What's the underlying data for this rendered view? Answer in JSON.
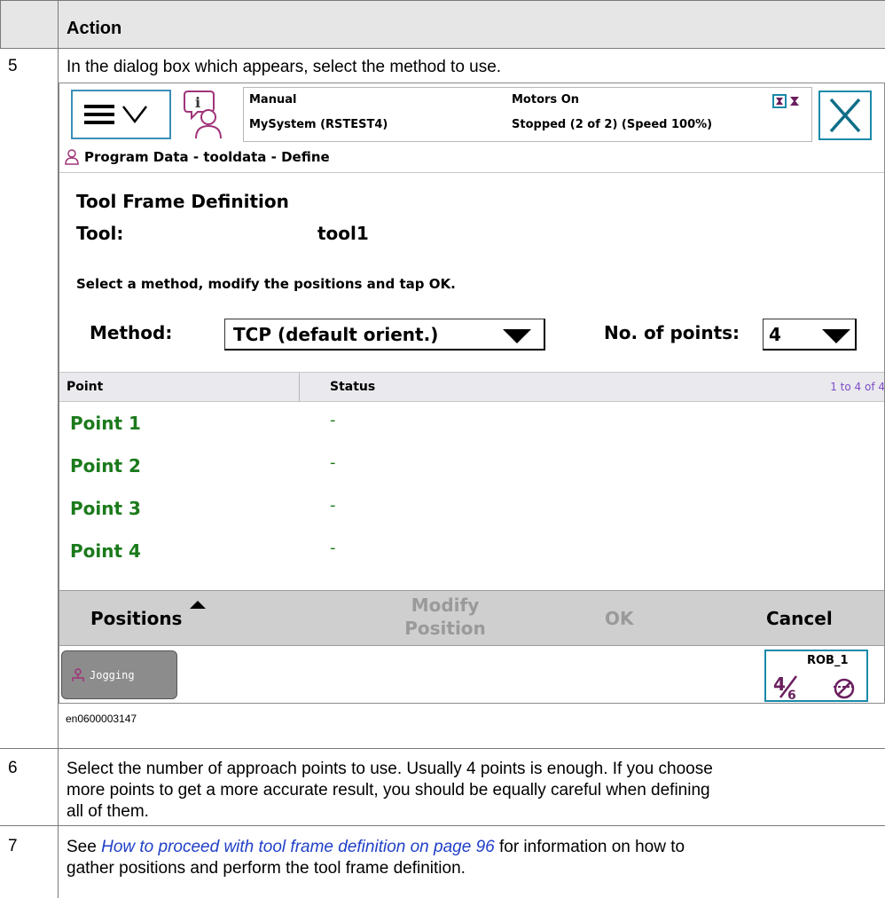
{
  "table": {
    "header": "Action",
    "steps": [
      {
        "num": "5",
        "text": "In the dialog box which appears, select the method to use."
      },
      {
        "num": "6",
        "lines": [
          "Select the number of approach points to use. Usually 4 points is enough. If you choose",
          "more points to get a more accurate result, you should be equally careful when defining",
          "all of them."
        ]
      },
      {
        "num": "7",
        "link": "How to proceed with tool frame definition on page 96",
        "after": " for information on how to",
        "prefix": "See ",
        "line2": "gather positions and perform the tool frame definition."
      }
    ],
    "figure_caption": "en0600003147"
  },
  "screen": {
    "status": {
      "mode": "Manual",
      "system": "MySystem (RSTEST4)",
      "motors": "Motors On",
      "state": "Stopped (2 of 2) (Speed 100%)"
    },
    "breadcrumb": "Program Data - tooldata - Define",
    "frame_title": "Tool Frame Definition",
    "tool_label": "Tool:",
    "tool_value": "tool1",
    "instruction": "Select a method, modify the positions and tap OK.",
    "method_label": "Method:",
    "method_value": "TCP (default orient.)",
    "points_label": "No. of points:",
    "points_value": "4",
    "grid": {
      "columns": [
        "Point",
        "Status"
      ],
      "range": "1 to 4 of 4",
      "rows": [
        {
          "point": "Point  1",
          "status": "-"
        },
        {
          "point": "Point  2",
          "status": "-"
        },
        {
          "point": "Point  3",
          "status": "-"
        },
        {
          "point": "Point  4",
          "status": "-"
        }
      ]
    },
    "commands": {
      "positions": "Positions",
      "modify_line1": "Modify",
      "modify_line2": "Position",
      "ok": "OK",
      "cancel": "Cancel"
    },
    "jogging": "Jogging",
    "rob_label": "ROB_1",
    "icons": [
      "menu-icon",
      "info-event-icon",
      "close-icon",
      "user-icon",
      "jog-icon",
      "robot-task-icon"
    ],
    "colors": {
      "accent": "#1a8aa8",
      "point_green": "#1b7a1b",
      "range_purple": "#7e4dc8"
    }
  }
}
